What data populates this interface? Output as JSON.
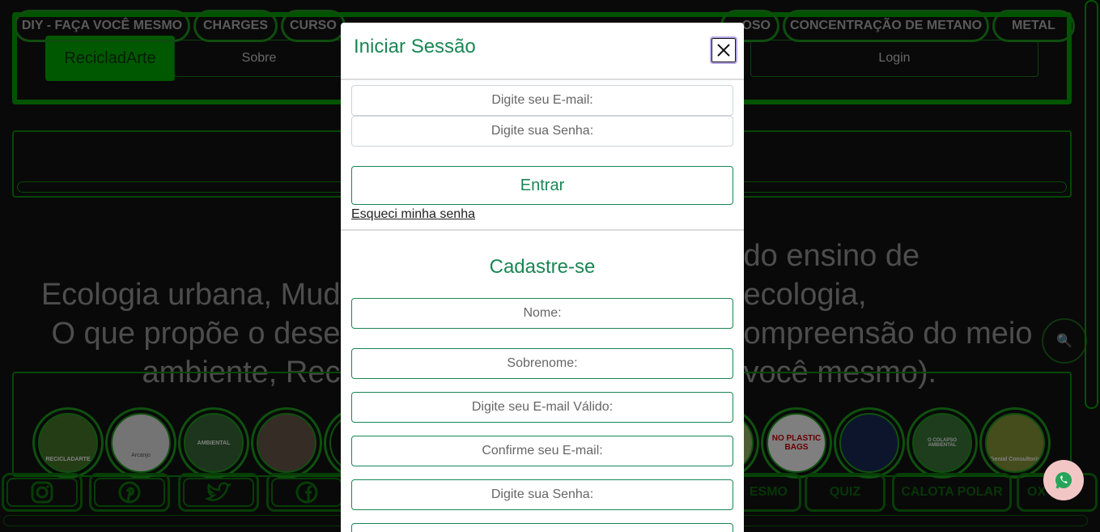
{
  "header": {
    "brand": "RecicladArte",
    "nav_about": "Sobre",
    "nav_login": "Login"
  },
  "categories": [
    "DIY - FAÇA VOCÊ MESMO",
    "CHARGES",
    "CURSO",
    "OSO",
    "CONCENTRAÇÃO DE METANO",
    "METAL"
  ],
  "headline": {
    "line1_left": "Ecologia urbana, Mud",
    "line1_right": "do ensino de ecologia,",
    "line2_left": "O que propõe o dese",
    "line2_right": "ompreensão do meio",
    "line3_left": "ambiente, Rec",
    "line3_right": "você mesmo)."
  },
  "avatars": [
    {
      "name": "RECICLADARTE",
      "color": "#4a7a2a"
    },
    {
      "name": "Arcanjo",
      "color": "#e8e8e8"
    },
    {
      "name": "AMBIENTAL",
      "color": "#3a6a3a"
    },
    {
      "name": "",
      "color": "#6a5a4a"
    },
    {
      "name": "",
      "color": "#111111"
    },
    {
      "name": "NO PLASTIC BAGS",
      "color": "#ffffff"
    },
    {
      "name": "",
      "color": "#1a2a5a"
    },
    {
      "name": "O COLAPSO AMBIENTAL",
      "color": "#3a7a3a"
    },
    {
      "name": "Genial Consultoria",
      "color": "#8a9a3a"
    }
  ],
  "bottom_tags": [
    "ESMO",
    "QUIZ",
    "CALOTA POLAR",
    "OX"
  ],
  "social_icons": [
    "instagram-icon",
    "pinterest-icon",
    "twitter-icon",
    "facebook-icon"
  ],
  "search_icon_glyph": "🔍",
  "modal": {
    "title": "Iniciar Sessão",
    "email_placeholder": "Digite seu E-mail:",
    "password_placeholder": "Digite sua Senha:",
    "enter_label": "Entrar",
    "forgot_label": "Esqueci minha senha",
    "register_title": "Cadastre-se",
    "name_placeholder": "Nome:",
    "surname_placeholder": "Sobrenome:",
    "valid_email_placeholder": "Digite seu E-mail Válido:",
    "confirm_email_placeholder": "Confirme seu E-mail:",
    "register_password_placeholder": "Digite sua Senha:"
  },
  "colors": {
    "accent_green": "#198754",
    "neon_green": "#00a800",
    "background": "#121212"
  }
}
